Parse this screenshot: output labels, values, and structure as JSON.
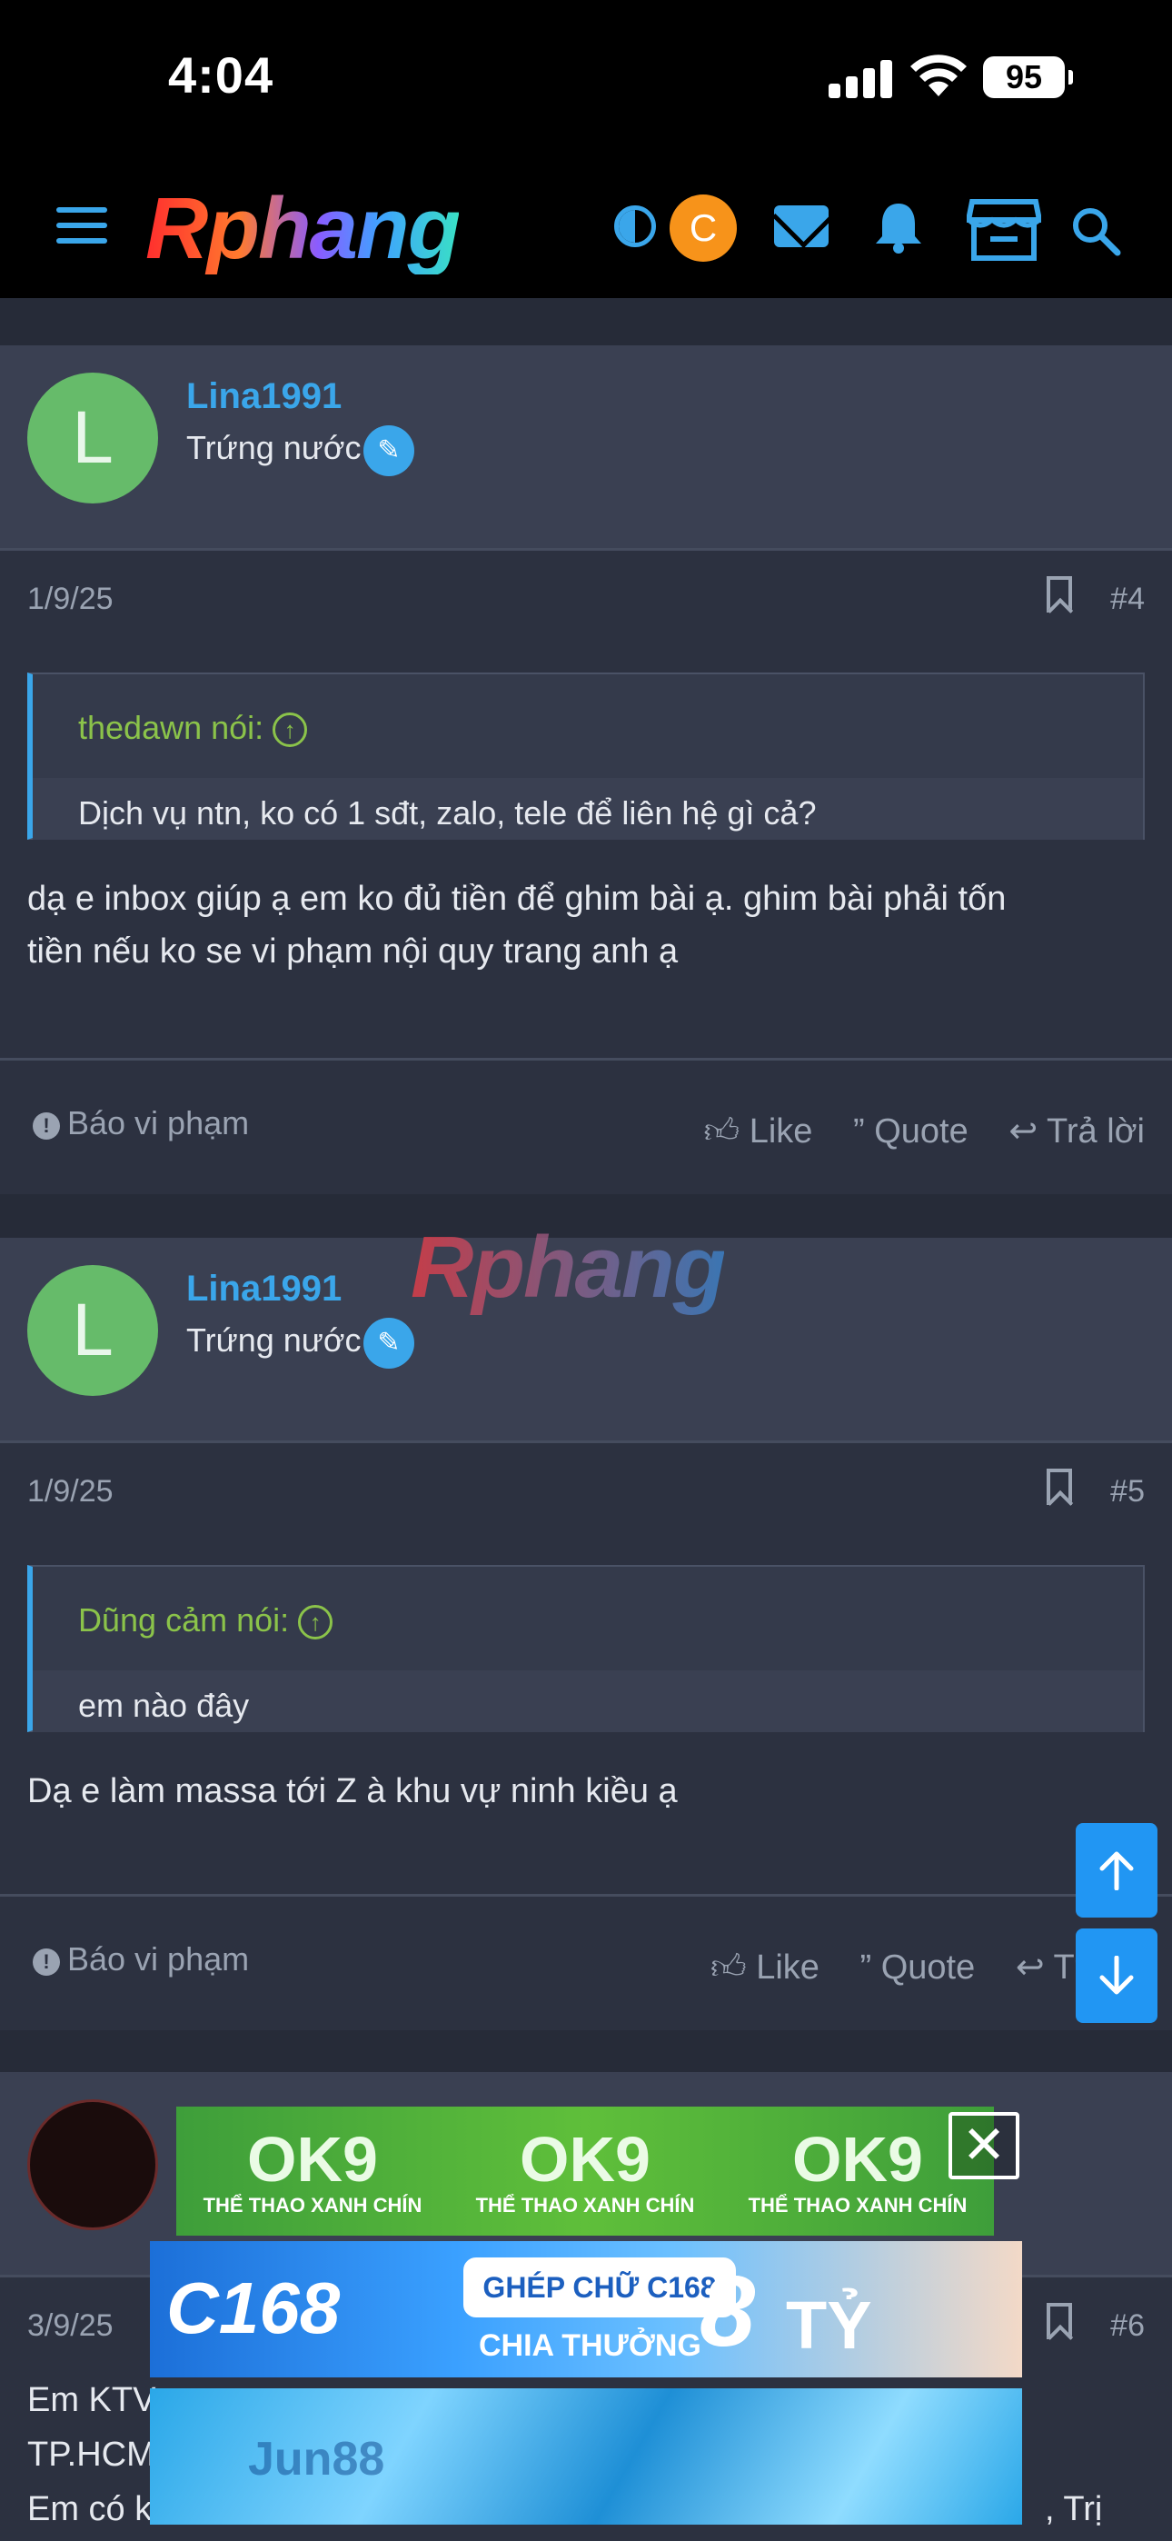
{
  "status_bar": {
    "time": "4:04",
    "battery": "95"
  },
  "header": {
    "logo": "Rphang",
    "avatar_letter": "C"
  },
  "posts": [
    {
      "avatar_letter": "L",
      "username": "Lina1991",
      "user_title": "Trứng nước",
      "date": "1/9/25",
      "number": "#4",
      "quote_author": "thedawn nói:",
      "quote_text": "Dịch vụ ntn, ko có 1 sđt, zalo, tele để liên hệ gì cả?",
      "message_line1": "dạ e inbox giúp ạ em ko đủ tiền để ghim bài ạ. ghim bài phải tốn",
      "message_line2": "tiền nếu ko se vi phạm nội quy trang anh ạ",
      "report": "Báo vi phạm",
      "like": "Like",
      "quote": "Quote",
      "reply": "Trả lời"
    },
    {
      "avatar_letter": "L",
      "username": "Lina1991",
      "user_title": "Trứng nước",
      "date": "1/9/25",
      "number": "#5",
      "quote_author": "Dũng cảm nói:",
      "quote_text": "em nào đây",
      "message_line1": "Dạ e làm massa tới Z à khu vự ninh kiều ạ",
      "report": "Báo vi phạm",
      "like": "Like",
      "quote": "Quote",
      "reply": "Tr"
    },
    {
      "date": "3/9/25",
      "number": "#6",
      "line1": "Em KTV",
      "line2": "TP.HCM",
      "line3": "Em có k",
      "line3_end": ", Trị"
    }
  ],
  "watermark": "Rphang",
  "ads": {
    "ok9_logo": "OK9",
    "ok9_sub": "THỂ THAO XANH CHÍN",
    "close": "✕",
    "c168_logo": "C168",
    "c168_box": "GHÉP CHỮ C168",
    "c168_sub": "CHIA THƯỞNG",
    "c168_big": "8",
    "c168_ty": "TỶ",
    "jun88_logo": "Jun88"
  }
}
